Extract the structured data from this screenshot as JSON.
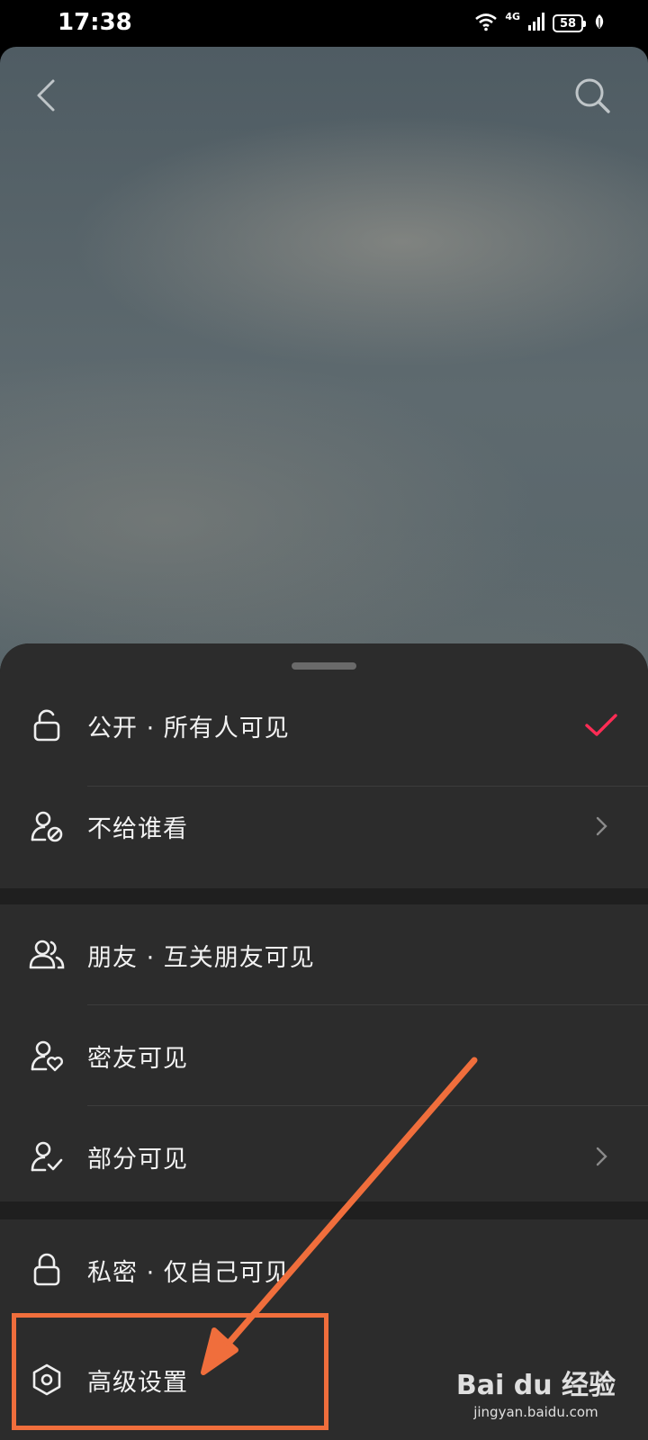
{
  "status_bar": {
    "time": "17:38",
    "network": "4G",
    "battery": "58"
  },
  "top_bar": {
    "back_icon": "chevron-left-icon",
    "search_icon": "search-icon"
  },
  "visibility_sheet": {
    "groups": [
      {
        "items": [
          {
            "label": "公开 · 所有人可见",
            "icon": "unlock-icon",
            "right_icon": "check-icon",
            "selected": true
          },
          {
            "label": "不给谁看",
            "icon": "user-block-icon",
            "right_icon": "chevron-right-icon"
          }
        ]
      },
      {
        "items": [
          {
            "label": "朋友 · 互关朋友可见",
            "icon": "users-icon"
          },
          {
            "label": "密友可见",
            "icon": "user-heart-icon"
          },
          {
            "label": "部分可见",
            "icon": "user-check-icon",
            "right_icon": "chevron-right-icon"
          }
        ]
      },
      {
        "items": [
          {
            "label": "私密 · 仅自己可见",
            "icon": "lock-icon"
          },
          {
            "label": "高级设置",
            "icon": "hexagon-settings-icon",
            "right_icon": "chevron-right-icon"
          }
        ]
      }
    ]
  },
  "colors": {
    "accent_check": "#fe2c55",
    "annotation": "#f06e3c",
    "sheet_bg": "#2c2c2c"
  },
  "watermark": {
    "brand": "Bai du 经验",
    "url": "jingyan.baidu.com"
  }
}
